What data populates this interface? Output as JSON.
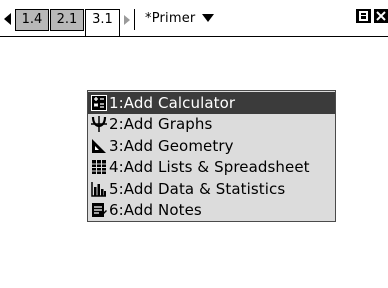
{
  "tabs": [
    {
      "label": "1.4",
      "active": false
    },
    {
      "label": "2.1",
      "active": false
    },
    {
      "label": "3.1",
      "active": true
    }
  ],
  "document": {
    "title": "*Primer"
  },
  "icons": {
    "scroll_left": "triangle-left-icon",
    "scroll_right": "triangle-right-icon",
    "document_menu": "triangle-down-icon",
    "status": "battery-icon",
    "close": "close-icon"
  },
  "menu": {
    "items": [
      {
        "label": "1:Add Calculator",
        "icon": "calculator-icon",
        "selected": true
      },
      {
        "label": "2:Add Graphs",
        "icon": "graph-icon",
        "selected": false
      },
      {
        "label": "3:Add Geometry",
        "icon": "geometry-icon",
        "selected": false
      },
      {
        "label": "4:Add Lists & Spreadsheet",
        "icon": "spreadsheet-icon",
        "selected": false
      },
      {
        "label": "5:Add Data & Statistics",
        "icon": "statistics-icon",
        "selected": false
      },
      {
        "label": "6:Add Notes",
        "icon": "notes-icon",
        "selected": false
      }
    ]
  },
  "colors": {
    "selected_bg": "#3b3b3b",
    "menu_bg": "#dcdcdc",
    "inactive_tab_bg": "#b8b8b8"
  }
}
